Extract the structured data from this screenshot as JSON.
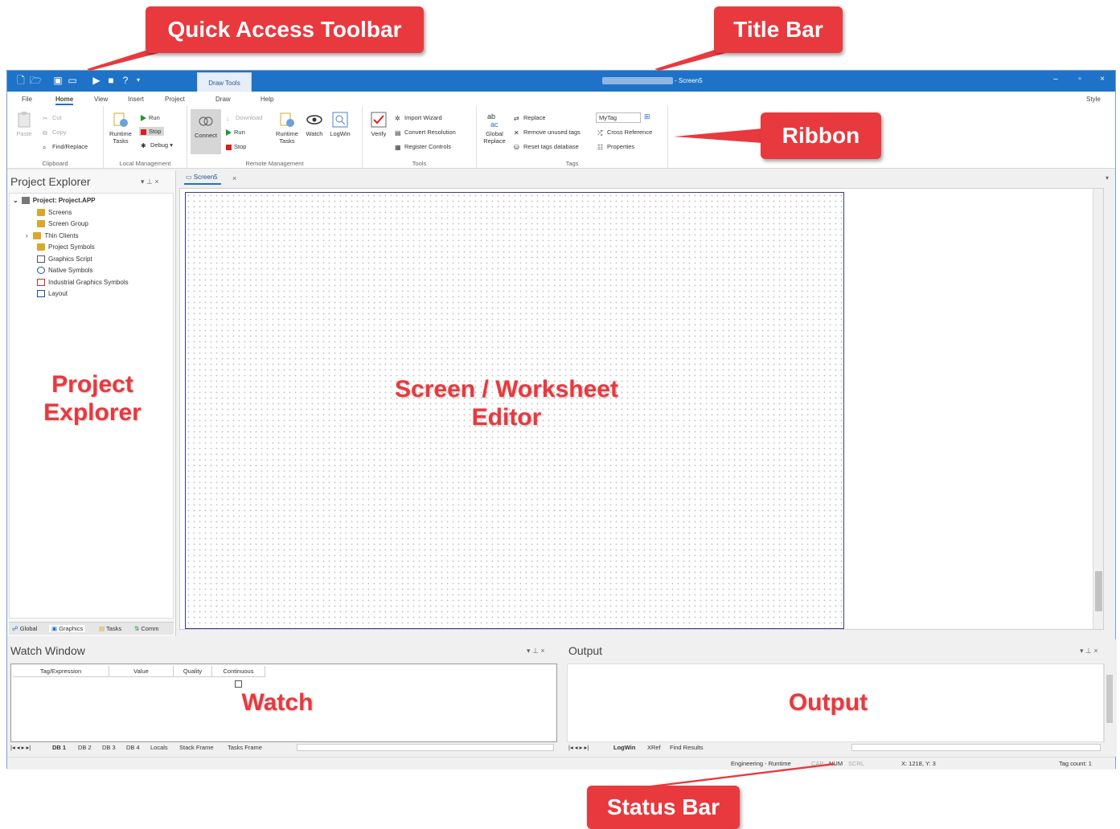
{
  "callouts": {
    "quick_access": "Quick Access Toolbar",
    "title_bar": "Title Bar",
    "ribbon": "Ribbon",
    "status_bar": "Status Bar"
  },
  "overlays": {
    "project_explorer_1": "Project",
    "project_explorer_2": "Explorer",
    "editor_1": "Screen / Worksheet",
    "editor_2": "Editor",
    "watch": "Watch",
    "output": "Output"
  },
  "titlebar": {
    "context_tab": "Draw Tools",
    "title": "- Screen5",
    "minimize": "‒",
    "maximize": "▫",
    "close": "×"
  },
  "menu": {
    "file": "File",
    "home": "Home",
    "view": "View",
    "insert": "Insert",
    "project": "Project",
    "draw": "Draw",
    "help": "Help",
    "style": "Style"
  },
  "ribbon": {
    "clipboard": {
      "label": "Clipboard",
      "paste": "Paste",
      "cut": "Cut",
      "copy": "Copy",
      "find_replace": "Find/Replace"
    },
    "local_mgmt": {
      "label": "Local Management",
      "runtime_tasks": "Runtime Tasks",
      "run": "Run",
      "stop": "Stop",
      "debug": "Debug"
    },
    "remote_mgmt": {
      "label": "Remote Management",
      "connect": "Connect",
      "download": "Download",
      "run": "Run",
      "stop": "Stop",
      "runtime_tasks": "Runtime Tasks",
      "watch": "Watch",
      "logwin": "LogWin"
    },
    "tools": {
      "label": "Tools",
      "verify": "Verify",
      "import_wizard": "Import Wizard",
      "convert_resolution": "Convert Resolution",
      "register_controls": "Register Controls"
    },
    "tags": {
      "label": "Tags",
      "global_replace": "Global Replace",
      "replace": "Replace",
      "remove_unused": "Remove unused tags",
      "reset_tags_db": "Reset tags database",
      "tag_input_value": "MyTag",
      "cross_reference": "Cross Reference",
      "properties": "Properties"
    }
  },
  "project_explorer": {
    "title": "Project Explorer",
    "tree": {
      "root": "Project: Project.APP",
      "items": [
        "Screens",
        "Screen Group",
        "Thin Clients",
        "Project Symbols",
        "Graphics Script",
        "Native Symbols",
        "Industrial Graphics Symbols",
        "Layout"
      ]
    },
    "tabs": [
      "Global",
      "Graphics",
      "Tasks",
      "Comm"
    ]
  },
  "document": {
    "tab": "Screen5",
    "close": "×"
  },
  "watch": {
    "title": "Watch Window",
    "columns": [
      "Tag/Expression",
      "Value",
      "Quality",
      "Continuous"
    ],
    "tabs": [
      "DB 1",
      "DB 2",
      "DB 3",
      "DB 4",
      "Locals",
      "Stack Frame",
      "Tasks Frame"
    ]
  },
  "output": {
    "title": "Output",
    "tabs": [
      "LogWin",
      "XRef",
      "Find Results"
    ]
  },
  "statusbar": {
    "mode": "Engineering - Runtime",
    "cap": "CAP",
    "num": "NUM",
    "scrl": "SCRL",
    "coords": "X: 1218, Y: 3",
    "tag_count": "Tag count: 1"
  },
  "colors": {
    "titlebar": "#1e73c8",
    "callout": "#e8393e",
    "canvas_border": "#3a3a8c"
  }
}
